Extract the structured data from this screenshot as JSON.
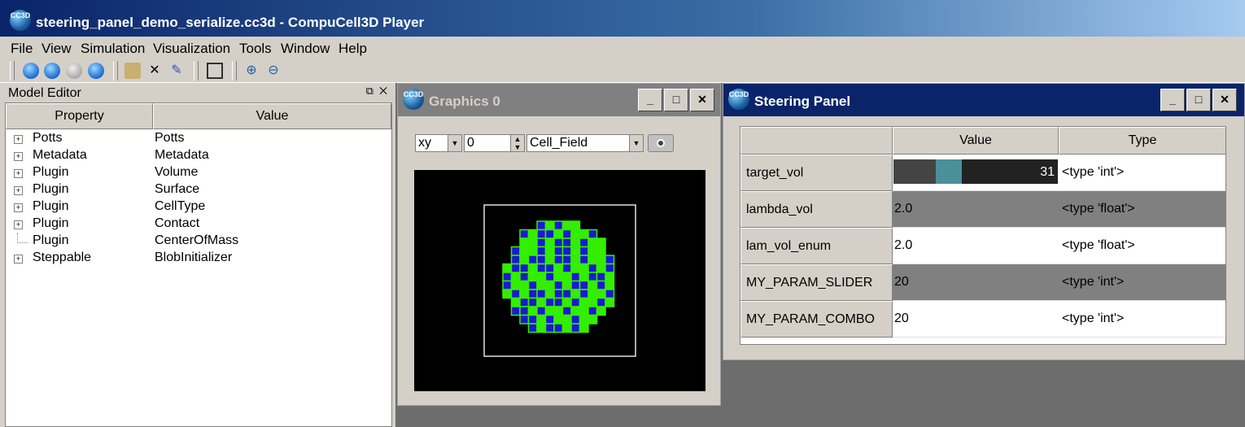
{
  "app": {
    "title": "steering_panel_demo_serialize.cc3d - CompuCell3D Player",
    "logo_text": "CC3D"
  },
  "menu": [
    "File",
    "View",
    "Simulation",
    "Visualization",
    "Tools",
    "Window",
    "Help"
  ],
  "model_editor": {
    "title": "Model Editor",
    "columns": [
      "Property",
      "Value"
    ],
    "rows": [
      {
        "property": "Potts",
        "value": "Potts",
        "expandable": true
      },
      {
        "property": "Metadata",
        "value": "Metadata",
        "expandable": true
      },
      {
        "property": "Plugin",
        "value": "Volume",
        "expandable": true
      },
      {
        "property": "Plugin",
        "value": "Surface",
        "expandable": true
      },
      {
        "property": "Plugin",
        "value": "CellType",
        "expandable": true
      },
      {
        "property": "Plugin",
        "value": "Contact",
        "expandable": true
      },
      {
        "property": "Plugin",
        "value": "CenterOfMass",
        "expandable": false
      },
      {
        "property": "Steppable",
        "value": "BlobInitializer",
        "expandable": true
      }
    ]
  },
  "graphics": {
    "title": "Graphics 0",
    "plane": "xy",
    "position": "0",
    "field": "Cell_Field"
  },
  "steering": {
    "title": "Steering Panel",
    "columns": [
      "Value",
      "Type"
    ],
    "rows": [
      {
        "name": "target_vol",
        "value": "31",
        "type": "<type 'int'>",
        "slider": true
      },
      {
        "name": "lambda_vol",
        "value": "2.0",
        "type": "<type 'float'>",
        "shaded": true
      },
      {
        "name": "lam_vol_enum",
        "value": "2.0",
        "type": "<type 'float'>"
      },
      {
        "name": "MY_PARAM_SLIDER",
        "value": "20",
        "type": "<type 'int'>",
        "shaded": true
      },
      {
        "name": "MY_PARAM_COMBO",
        "value": "20",
        "type": "<type 'int'>"
      }
    ]
  },
  "colors": {
    "cell_green": "#33ee00",
    "cell_blue": "#1a1ad0",
    "shaded_row": "#808080"
  }
}
